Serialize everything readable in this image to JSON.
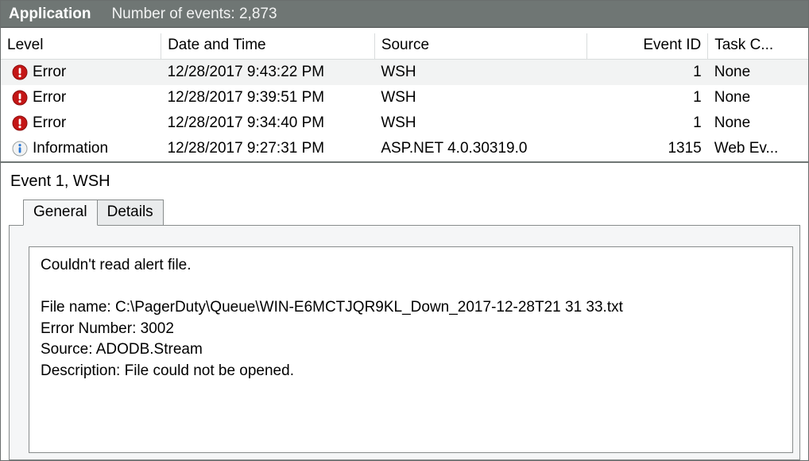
{
  "titlebar": {
    "app_label": "Application",
    "count_label": "Number of events: 2,873"
  },
  "grid": {
    "headers": {
      "level": "Level",
      "date": "Date and Time",
      "source": "Source",
      "event_id": "Event ID",
      "task": "Task C..."
    },
    "rows": [
      {
        "icon": "error",
        "level": "Error",
        "date": "12/28/2017 9:43:22 PM",
        "source": "WSH",
        "event_id": "1",
        "task": "None",
        "selected": true
      },
      {
        "icon": "error",
        "level": "Error",
        "date": "12/28/2017 9:39:51 PM",
        "source": "WSH",
        "event_id": "1",
        "task": "None",
        "selected": false
      },
      {
        "icon": "error",
        "level": "Error",
        "date": "12/28/2017 9:34:40 PM",
        "source": "WSH",
        "event_id": "1",
        "task": "None",
        "selected": false
      },
      {
        "icon": "information",
        "level": "Information",
        "date": "12/28/2017 9:27:31 PM",
        "source": "ASP.NET 4.0.30319.0",
        "event_id": "1315",
        "task": "Web Ev...",
        "selected": false
      }
    ]
  },
  "detail": {
    "title": "Event 1, WSH",
    "tabs": {
      "general": "General",
      "details": "Details"
    },
    "message_line1": "Couldn't read alert file.",
    "message_line2": "File name: C:\\PagerDuty\\Queue\\WIN-E6MCTJQR9KL_Down_2017-12-28T21 31 33.txt",
    "message_line3": "Error Number: 3002",
    "message_line4": "Source: ADODB.Stream",
    "message_line5": "Description: File could not be opened."
  }
}
